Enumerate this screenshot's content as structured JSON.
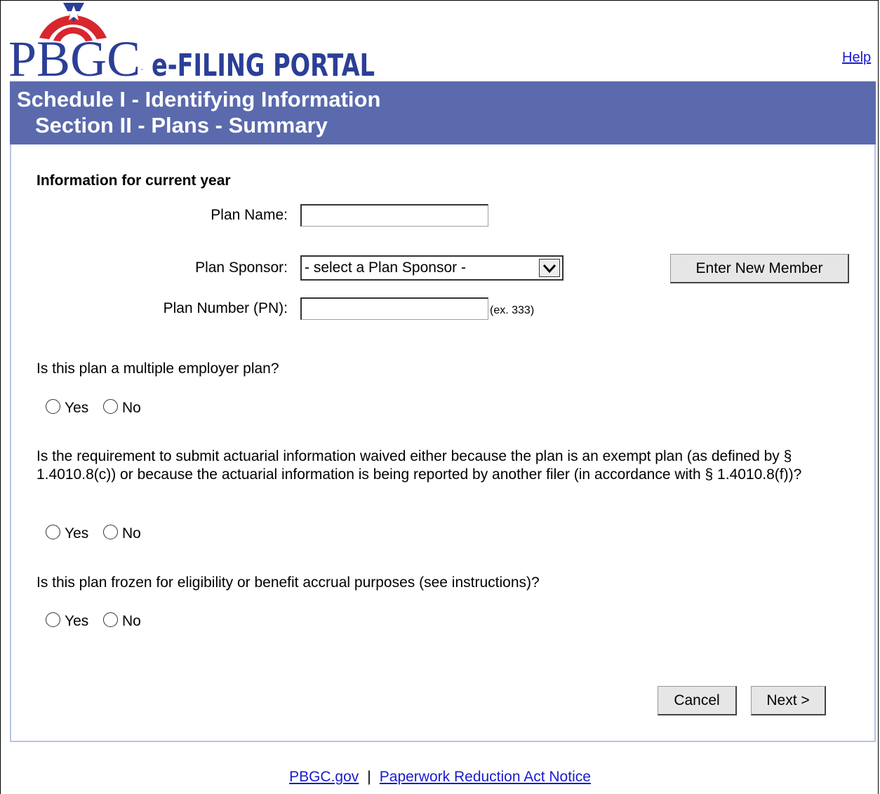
{
  "header": {
    "logo_text": "PBGC",
    "portal_text": "e-FILING PORTAL",
    "help_link": "Help"
  },
  "banner": {
    "title": "Schedule I - Identifying Information",
    "subtitle": "Section II - Plans - Summary"
  },
  "form": {
    "heading": "Information for current year",
    "plan_name": {
      "label": "Plan Name:",
      "value": ""
    },
    "plan_sponsor": {
      "label": "Plan Sponsor:",
      "selected": "- select a Plan Sponsor -"
    },
    "enter_new_member_label": "Enter New Member",
    "plan_number": {
      "label": "Plan Number (PN):",
      "value": "",
      "hint": "(ex. 333)"
    },
    "questions": [
      {
        "text": "Is this plan a multiple employer plan?",
        "yes": "Yes",
        "no": "No"
      },
      {
        "text": "Is the requirement to submit actuarial information waived either because the plan is an exempt plan (as defined by § 1.4010.8(c)) or because the actuarial information is being reported by another filer (in accordance with § 1.4010.8(f))?",
        "yes": "Yes",
        "no": "No"
      },
      {
        "text": "Is this plan frozen for eligibility or benefit accrual purposes (see instructions)?",
        "yes": "Yes",
        "no": "No"
      }
    ],
    "cancel_label": "Cancel",
    "next_label": "Next >"
  },
  "footer": {
    "link1": "PBGC.gov",
    "separator": "|",
    "link2": "Paperwork Reduction Act Notice"
  },
  "colors": {
    "banner": "#5b6aad",
    "panel_border": "#b7c4e6",
    "link": "#1a1ad0",
    "logo_blue": "#2b3f97",
    "logo_red": "#d8262e"
  }
}
